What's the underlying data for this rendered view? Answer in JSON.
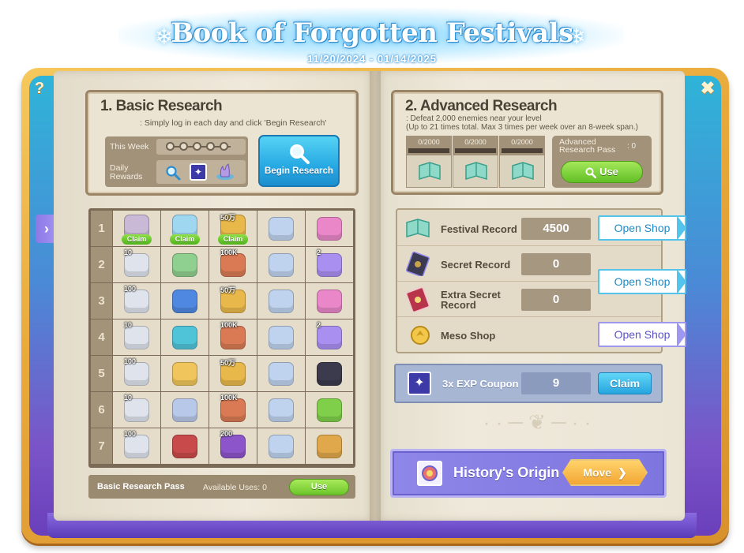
{
  "header": {
    "title": "Book of Forgotten Festivals",
    "dates": "11/20/2024 - 01/14/2025"
  },
  "frame": {
    "help_icon": "?",
    "close_icon": "✖"
  },
  "basic": {
    "title": "1. Basic Research",
    "subtitle": ": Simply log in each day and click 'Begin Research'",
    "this_week_label": "This Week",
    "daily_rewards_label": "Daily Rewards",
    "week_progress": 0,
    "begin_button": "Begin Research",
    "rows": [
      {
        "num": "1",
        "items": [
          {
            "name": "ring-item",
            "badge": "",
            "claim": "Claim",
            "color": "#c9b9d6"
          },
          {
            "name": "wings-item",
            "badge": "",
            "claim": "Claim",
            "color": "#9fd6f0"
          },
          {
            "name": "emblem-gold-item",
            "badge": "50万",
            "claim": "Claim",
            "color": "#e9b84a"
          },
          {
            "name": "ticket-item",
            "badge": "",
            "claim": "",
            "color": "#bfd3ee"
          },
          {
            "name": "wand-pink-item",
            "badge": "",
            "claim": "",
            "color": "#e987c9"
          }
        ]
      },
      {
        "num": "2",
        "items": [
          {
            "name": "snowballs-item",
            "badge": "10",
            "claim": "",
            "color": "#dfe3ec"
          },
          {
            "name": "map-item",
            "badge": "",
            "claim": "",
            "color": "#8fcf8f"
          },
          {
            "name": "scroll-item",
            "badge": "100K",
            "claim": "",
            "color": "#d97a55"
          },
          {
            "name": "ticket-item",
            "badge": "",
            "claim": "",
            "color": "#bfd3ee"
          },
          {
            "name": "orb-purple-item",
            "badge": "2",
            "claim": "",
            "color": "#a98ff0"
          }
        ]
      },
      {
        "num": "3",
        "items": [
          {
            "name": "snowballs-item",
            "badge": "100",
            "claim": "",
            "color": "#dfe3ec"
          },
          {
            "name": "calendar-item",
            "badge": "",
            "claim": "",
            "color": "#4f88e0"
          },
          {
            "name": "emblem-gold-item",
            "badge": "50万",
            "claim": "",
            "color": "#e9b84a"
          },
          {
            "name": "ticket-item",
            "badge": "",
            "claim": "",
            "color": "#bfd3ee"
          },
          {
            "name": "wand-pink-item",
            "badge": "",
            "claim": "",
            "color": "#e987c9"
          }
        ]
      },
      {
        "num": "4",
        "items": [
          {
            "name": "snowballs-item",
            "badge": "10",
            "claim": "",
            "color": "#dfe3ec"
          },
          {
            "name": "portal-item",
            "badge": "",
            "claim": "",
            "color": "#4fc3d8"
          },
          {
            "name": "scroll-item",
            "badge": "100K",
            "claim": "",
            "color": "#d97a55"
          },
          {
            "name": "ticket-item",
            "badge": "",
            "claim": "",
            "color": "#bfd3ee"
          },
          {
            "name": "orb-purple-item",
            "badge": "2",
            "claim": "",
            "color": "#a98ff0"
          }
        ]
      },
      {
        "num": "5",
        "items": [
          {
            "name": "snowballs-item",
            "badge": "100",
            "claim": "",
            "color": "#dfe3ec"
          },
          {
            "name": "gift-box-item",
            "badge": "",
            "claim": "",
            "color": "#f0c55b"
          },
          {
            "name": "emblem-gold-item",
            "badge": "50万",
            "claim": "",
            "color": "#e9b84a"
          },
          {
            "name": "ticket-item",
            "badge": "",
            "claim": "",
            "color": "#bfd3ee"
          },
          {
            "name": "hat-star-item",
            "badge": "",
            "claim": "",
            "color": "#3b3b4d"
          }
        ]
      },
      {
        "num": "6",
        "items": [
          {
            "name": "snowballs-item",
            "badge": "10",
            "claim": "",
            "color": "#dfe3ec"
          },
          {
            "name": "character-card-item",
            "badge": "",
            "claim": "",
            "color": "#b8c8e8"
          },
          {
            "name": "scroll-item",
            "badge": "100K",
            "claim": "",
            "color": "#d97a55"
          },
          {
            "name": "ticket-item",
            "badge": "",
            "claim": "",
            "color": "#bfd3ee"
          },
          {
            "name": "green-ticket-item",
            "badge": "",
            "claim": "",
            "color": "#7fcf4a"
          }
        ]
      },
      {
        "num": "7",
        "items": [
          {
            "name": "snowballs-item",
            "badge": "100",
            "claim": "",
            "color": "#dfe3ec"
          },
          {
            "name": "nameplate-item",
            "badge": "",
            "claim": "",
            "color": "#c94a4a"
          },
          {
            "name": "chest-item",
            "badge": "200",
            "claim": "",
            "color": "#8c55c9"
          },
          {
            "name": "ticket-item",
            "badge": "",
            "claim": "",
            "color": "#bfd3ee"
          },
          {
            "name": "wand-gold-item",
            "badge": "",
            "claim": "",
            "color": "#e0a84a"
          }
        ]
      }
    ],
    "pass_label": "Basic Research Pass",
    "available_uses": "Available Uses: 0",
    "use_button": "Use"
  },
  "advanced": {
    "title": "2. Advanced Research",
    "subtitle1": ": Defeat 2,000 enemies near your level",
    "subtitle2": "(Up to 21 times total. Max 3 times per week over an 8-week span.)",
    "counters": [
      "0/2000",
      "0/2000",
      "0/2000"
    ],
    "pass_label": "Advanced Research Pass",
    "pass_count": ": 0",
    "use_button": "Use"
  },
  "shops": [
    {
      "label": "Festival Record",
      "value": "4500",
      "icon": "festival-record-icon",
      "button": "Open Shop",
      "style": "blue"
    },
    {
      "label": "Secret Record",
      "value": "0",
      "icon": "secret-record-icon",
      "button": "",
      "style": ""
    },
    {
      "label": "Extra Secret Record",
      "value": "0",
      "icon": "extra-secret-record-icon",
      "button": "",
      "style": ""
    },
    {
      "label": "Meso Shop",
      "value": "",
      "icon": "meso-coin-icon",
      "button": "Open Shop",
      "style": "purple"
    }
  ],
  "shared_shop_button": "Open Shop",
  "coupon": {
    "label": "3x EXP Coupon",
    "value": "9",
    "button": "Claim"
  },
  "history": {
    "label": "History's Origin",
    "button": "Move"
  },
  "colors": {
    "accent_blue": "#27a9e3",
    "accent_green": "#6cc52a",
    "frame_gold": "#e9a93a",
    "history_purple": "#8f86e8"
  }
}
